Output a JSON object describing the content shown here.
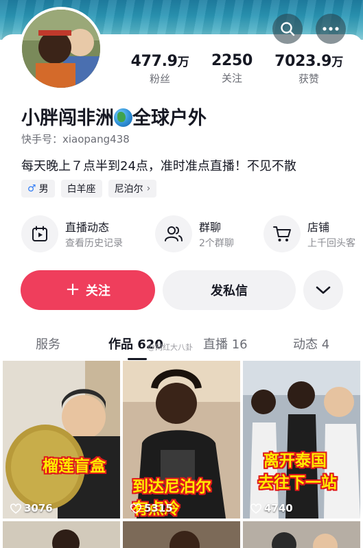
{
  "header": {
    "back_label": "<"
  },
  "stats": [
    {
      "value": "477.9",
      "unit": "万",
      "label": "粉丝"
    },
    {
      "value": "2250",
      "unit": "",
      "label": "关注"
    },
    {
      "value": "7023.9",
      "unit": "万",
      "label": "获赞"
    }
  ],
  "profile": {
    "name_part1": "小胖闯非洲",
    "name_part2": "全球户外",
    "kwai_id": "快手号：xiaopang438",
    "bio": "每天晚上７点半到24点，准时准点直播！不见不散"
  },
  "tags": {
    "gender_symbol": "♂",
    "gender": "男",
    "zodiac": "白羊座",
    "location": "尼泊尔",
    "location_chevron": "›"
  },
  "features": [
    {
      "title": "直播动态",
      "subtitle": "查看历史记录",
      "icon": "calendar-play-icon"
    },
    {
      "title": "群聊",
      "subtitle": "2个群聊",
      "icon": "group-icon"
    },
    {
      "title": "店铺",
      "subtitle": "上千回头客",
      "icon": "cart-icon"
    }
  ],
  "actions": {
    "follow_plus": "+",
    "follow": "关注",
    "message": "发私信"
  },
  "tabs": [
    {
      "label": "服务",
      "active": false
    },
    {
      "label": "作品 620",
      "active": true
    },
    {
      "label": "直播 16",
      "active": false
    },
    {
      "label": "动态 4",
      "active": false
    }
  ],
  "watermark": "@网红大八卦",
  "videos": [
    {
      "caption_lines": [
        "榴莲盲盒"
      ],
      "likes": "3076"
    },
    {
      "caption_lines": [
        "到达尼泊尔",
        "有点冷"
      ],
      "likes": "5315"
    },
    {
      "caption_lines": [
        "离开泰国",
        "去往下一站"
      ],
      "likes": "4740"
    }
  ],
  "colors": {
    "accent": "#ef3e5c",
    "caption_fill": "#ffea00",
    "caption_stroke": "#e01b1b"
  }
}
